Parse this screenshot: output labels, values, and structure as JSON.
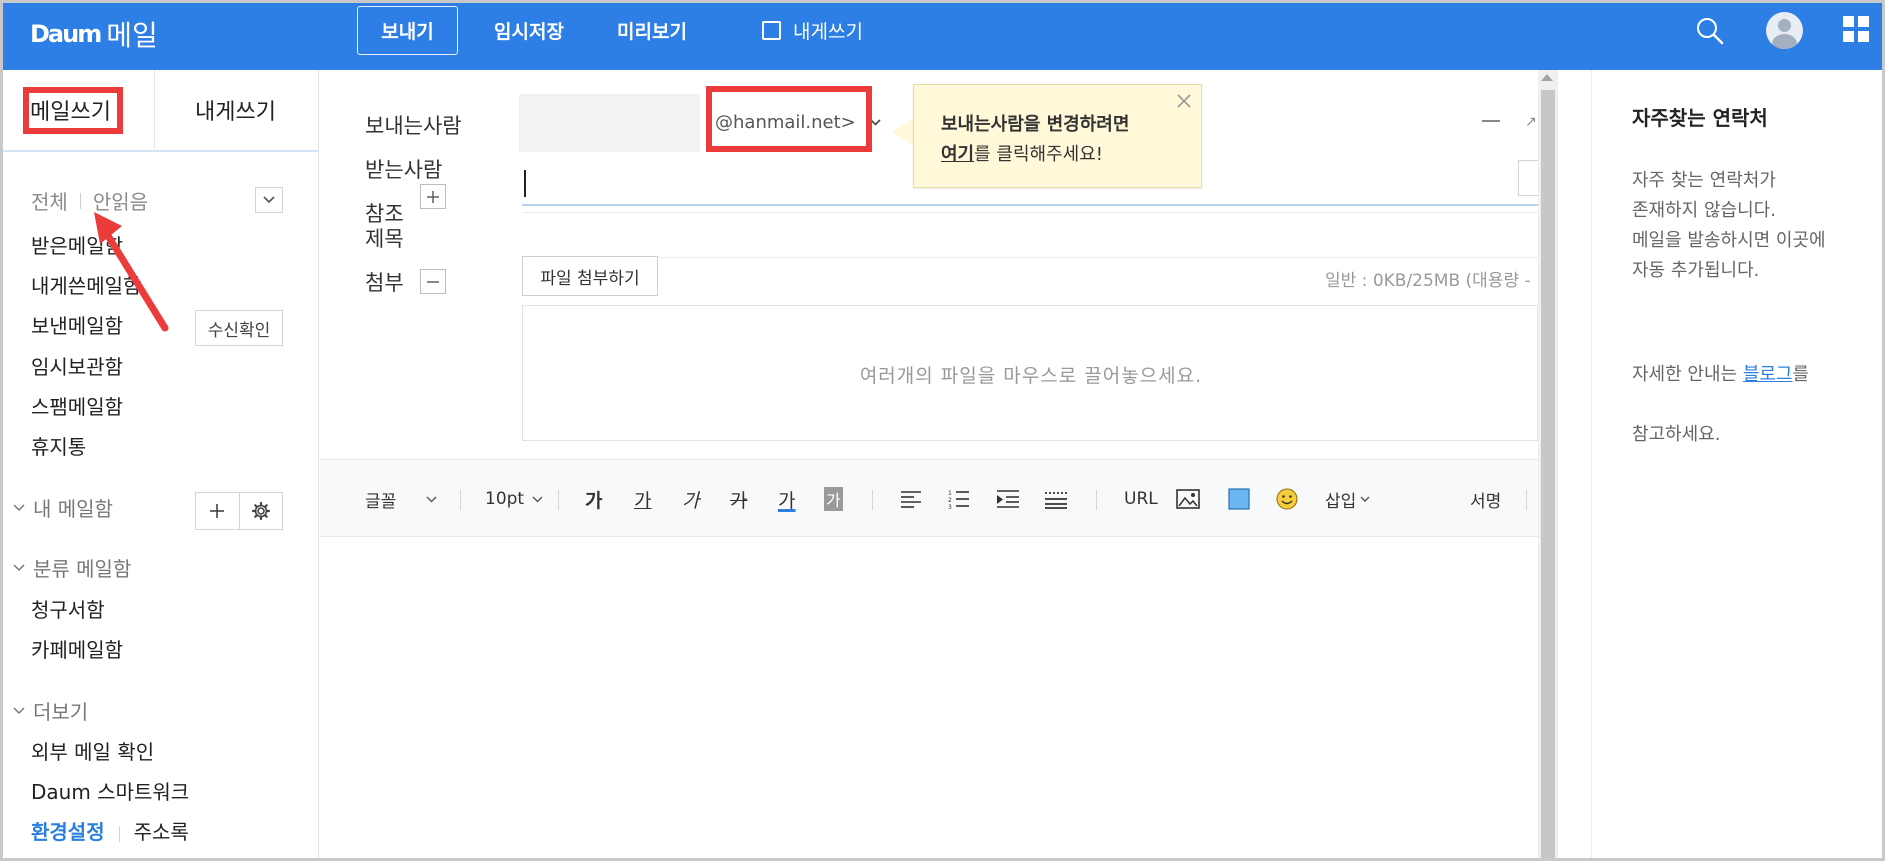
{
  "brand": {
    "logo": "Daum",
    "app_name": "메일"
  },
  "topbar": {
    "send": "보내기",
    "save_draft": "임시저장",
    "preview": "미리보기",
    "send_to_self": "내게쓰기",
    "send_to_self_checked": false
  },
  "sidebar": {
    "tab_write": "메일쓰기",
    "tab_self": "내게쓰기",
    "filter_all": "전체",
    "filter_unread": "안읽음",
    "folders": [
      "받은메일함",
      "내게쓴메일함",
      "보낸메일함",
      "임시보관함",
      "스팸메일함",
      "휴지통"
    ],
    "read_receipt_button": "수신확인",
    "my_mailboxes": "내 메일함",
    "category_mailboxes": "분류 메일함",
    "categories": [
      "청구서함",
      "카페메일함"
    ],
    "more": "더보기",
    "more_items": [
      "외부 메일 확인",
      "Daum 스마트워크"
    ],
    "settings": "환경설정",
    "address_book": "주소록"
  },
  "compose": {
    "from_label": "보내는사람",
    "from_domain": "@hanmail.net>",
    "to_label": "받는사람",
    "cc_label": "참조",
    "subject_label": "제목",
    "attach_label": "첨부",
    "attach_button": "파일 첨부하기",
    "attach_info": "일반 : 0KB/25MB (대용량 -",
    "drop_hint": "여러개의 파일을 마우스로 끌어놓으세요.",
    "tooltip_line1": "보내는사람을 변경하려면",
    "tooltip_link": "여기",
    "tooltip_line2_rest": "를 클릭해주세요!"
  },
  "editor_toolbar": {
    "font": "글꼴",
    "size": "10pt",
    "bold": "가",
    "underline": "가",
    "italic": "가",
    "strike": "가",
    "font_color": "가",
    "bg_color": "가",
    "url": "URL",
    "insert": "삽입",
    "signature": "서명"
  },
  "right_panel": {
    "title": "자주찾는 연락처",
    "empty_text": "자주 찾는 연락처가\n존재하지 않습니다.\n메일을 발송하시면 이곳에\n자동 추가됩니다.",
    "help_prefix": "자세한 안내는 ",
    "help_link": "블로그",
    "help_suffix": "를",
    "help_line2": "참고하세요."
  },
  "colors": {
    "brand_blue": "#2d7ee5",
    "annotation_red": "#ec3b3b",
    "tooltip_bg": "#fff8d9",
    "link_blue": "#2b7fde"
  },
  "icons": [
    "search-icon",
    "avatar-icon",
    "apps-grid-icon",
    "chevron-down-icon",
    "plus-icon",
    "gear-icon",
    "minus-icon",
    "close-icon",
    "image-icon",
    "emoji-icon",
    "color-swatch-icon",
    "align-left-icon",
    "ordered-list-icon",
    "indent-icon",
    "line-height-icon"
  ]
}
